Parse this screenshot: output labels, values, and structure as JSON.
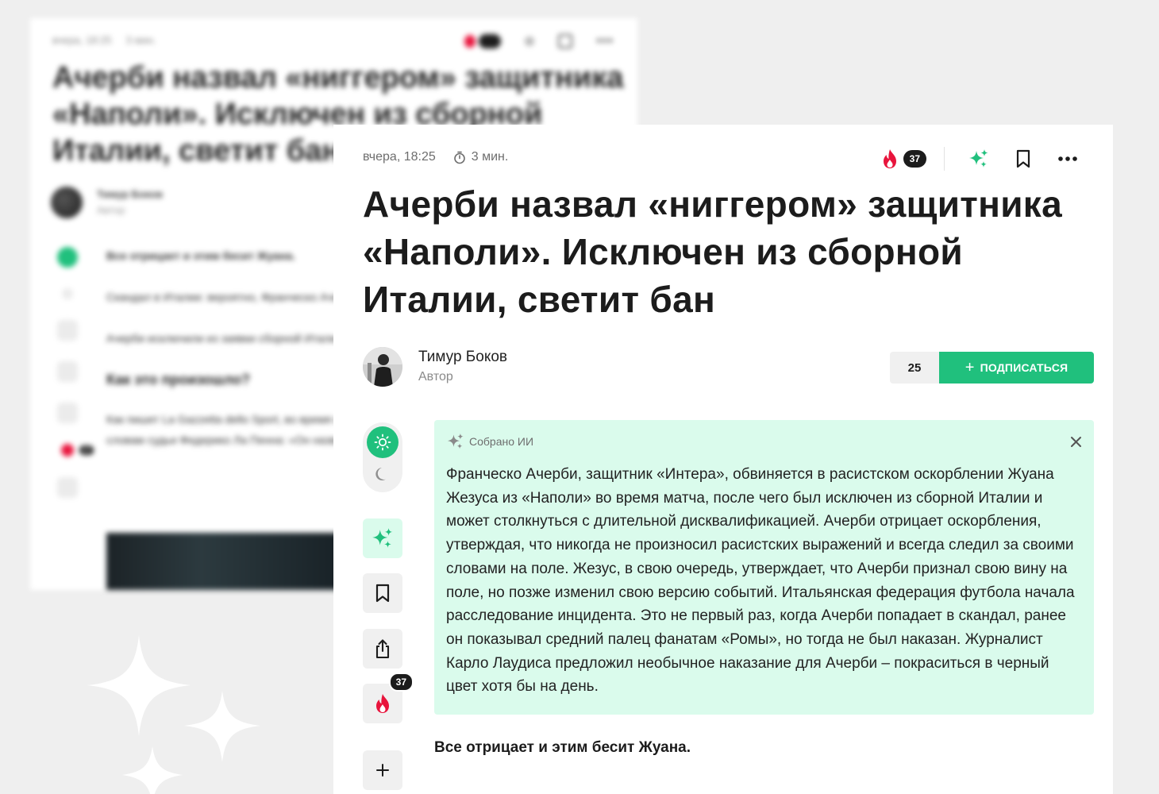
{
  "background_card": {
    "meta_date": "вчера, 18:25",
    "meta_read": "3 мин.",
    "title": "Ачерби назвал «ниггером» защитника «Наполи». Исключен из сборной Италии, светит бан",
    "author_name": "Тимур Боков",
    "author_role": "Автор",
    "paragraphs": [
      "Все отрицает и этим бесит Жуана.",
      "Скандал в Италии: вероятно, Франческо Ачерби оскорбил защитника «Наполи» Жуана Жезуса.",
      "Ачерби исключили из заявки сборной Италии, ему грозит дисквалификация."
    ],
    "subheading": "Как это произошло?",
    "paragraph_after": "Как пишет La Gazzetta dello Sport, во время матча Ачерби оскорбил Жуана на расовой почве. По словам судьи Федерико Ла Пенна: «Он назвал его»",
    "fire_count": "37"
  },
  "article": {
    "meta": {
      "date": "вчера, 18:25",
      "read_time": "3 мин."
    },
    "actions": {
      "fire_count": "37",
      "icons": [
        "fire-icon",
        "ai-sparkle-icon",
        "bookmark-icon",
        "more-icon"
      ]
    },
    "title": "Ачерби назвал «ниггером» защитника «Наполи». Исключен из сборной Италии, светит бан",
    "author": {
      "name": "Тимур Боков",
      "role": "Автор"
    },
    "subscribe": {
      "count": "25",
      "label": "ПОДПИСАТЬСЯ"
    },
    "rail": {
      "fire_count": "37",
      "icons": [
        "sun-icon",
        "moon-icon",
        "ai-sparkle-icon",
        "bookmark-icon",
        "share-icon",
        "fire-icon",
        "plus-icon"
      ]
    },
    "summary": {
      "label": "Собрано ИИ",
      "text": "Франческо Ачерби, защитник «Интера», обвиняется в расистском оскорблении Жуана Жезуса из «Наполи» во время матча, после чего был исключен из сборной Италии и может столкнуться с длительной дисквалификацией. Ачерби отрицает оскорбления, утверждая, что никогда не произносил расистских выражений и всегда следил за своими словами на поле. Жезус, в свою очередь, утверждает, что Ачерби признал свою вину на поле, но позже изменил свою версию событий. Итальянская федерация футбола начала расследование инцидента. Это не первый раз, когда Ачерби попадает в скандал, ранее он показывал средний палец фанатам «Ромы», но тогда не был наказан. Журналист Карло Лаудиса предложил необычное наказание для Ачерби – покраситься в черный цвет хотя бы на день."
    },
    "first_paragraph": "Все отрицает и этим бесит Жуана."
  },
  "colors": {
    "accent_green": "#20c07d",
    "summary_bg": "#dafbec",
    "fire_red": "#e8143c",
    "dark": "#1c1c1c",
    "page_bg": "#efefef"
  }
}
